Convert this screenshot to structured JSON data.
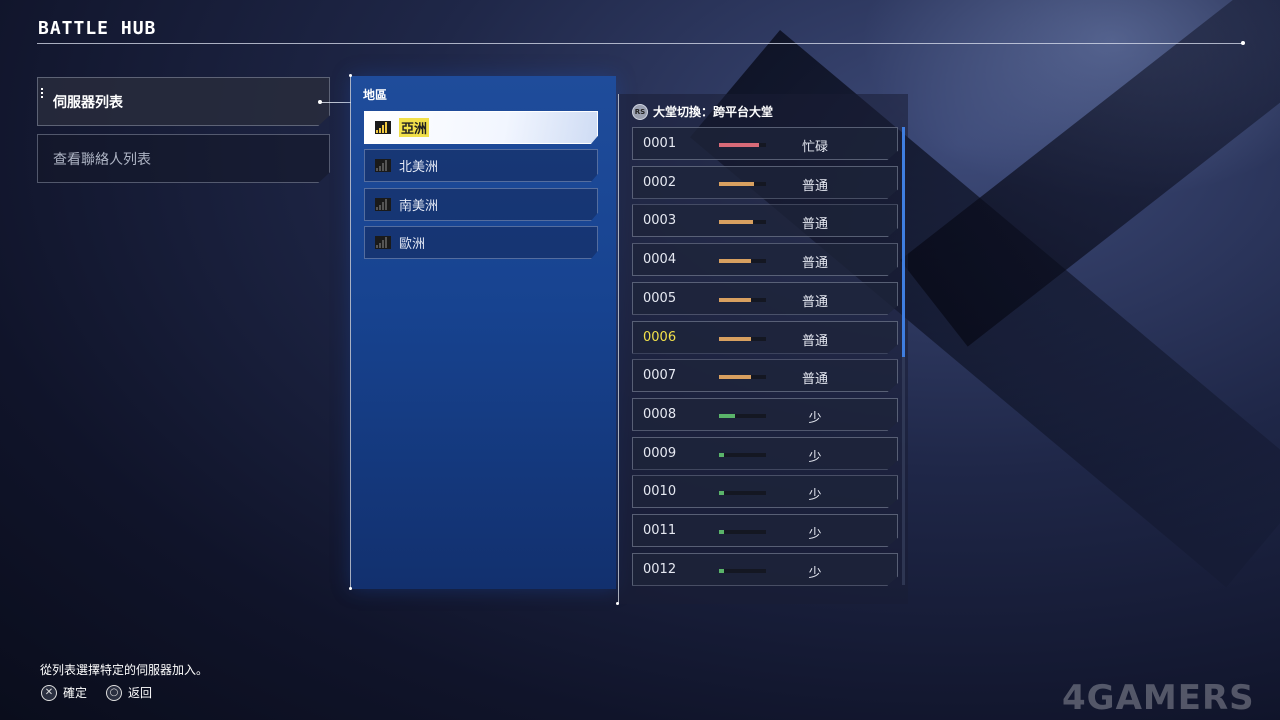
{
  "header": {
    "title": "BATTLE HUB"
  },
  "menu": {
    "items": [
      {
        "label": "伺服器列表",
        "active": true
      },
      {
        "label": "查看聯絡人列表",
        "active": false
      }
    ]
  },
  "region": {
    "title": "地區",
    "items": [
      {
        "label": "亞洲",
        "selected": true,
        "signal": 4
      },
      {
        "label": "北美洲",
        "selected": false,
        "signal": 0
      },
      {
        "label": "南美洲",
        "selected": false,
        "signal": 0
      },
      {
        "label": "歐洲",
        "selected": false,
        "signal": 0
      }
    ]
  },
  "lobby": {
    "icon_text": "RS",
    "label": "大堂切換：跨平台大堂"
  },
  "servers": [
    {
      "id": "0001",
      "status": "忙碌",
      "load": 0.85,
      "color": "#d86a78"
    },
    {
      "id": "0002",
      "status": "普通",
      "load": 0.75,
      "color": "#d8a060"
    },
    {
      "id": "0003",
      "status": "普通",
      "load": 0.72,
      "color": "#d8a060"
    },
    {
      "id": "0004",
      "status": "普通",
      "load": 0.68,
      "color": "#d8a060"
    },
    {
      "id": "0005",
      "status": "普通",
      "load": 0.68,
      "color": "#d8a060"
    },
    {
      "id": "0006",
      "status": "普通",
      "load": 0.68,
      "color": "#d8a060",
      "highlight": true
    },
    {
      "id": "0007",
      "status": "普通",
      "load": 0.68,
      "color": "#d8a060"
    },
    {
      "id": "0008",
      "status": "少",
      "load": 0.33,
      "color": "#5ab46a"
    },
    {
      "id": "0009",
      "status": "少",
      "load": 0.1,
      "color": "#5ab46a"
    },
    {
      "id": "0010",
      "status": "少",
      "load": 0.1,
      "color": "#5ab46a"
    },
    {
      "id": "0011",
      "status": "少",
      "load": 0.1,
      "color": "#5ab46a"
    },
    {
      "id": "0012",
      "status": "少",
      "load": 0.1,
      "color": "#5ab46a"
    }
  ],
  "footer": {
    "hint": "從列表選擇特定的伺服器加入。",
    "confirm_glyph": "✕",
    "confirm_label": "確定",
    "back_glyph": "○",
    "back_label": "返回"
  },
  "watermark": "4GAMERS"
}
